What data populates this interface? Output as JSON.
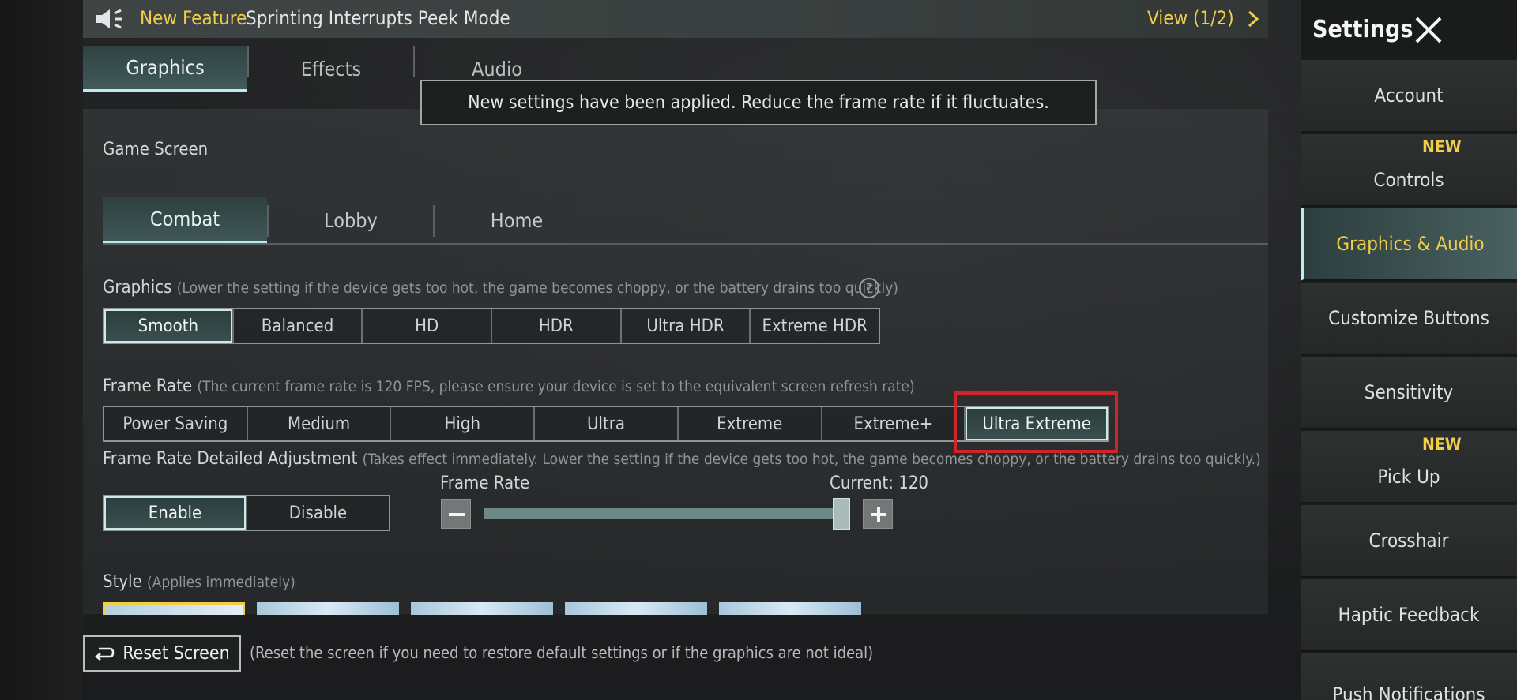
{
  "announcement": {
    "tag": "New Feature",
    "message": "Sprinting Interrupts Peek Mode",
    "view": "View (1/2)"
  },
  "main_tabs": [
    {
      "label": "Graphics",
      "active": true
    },
    {
      "label": "Effects",
      "active": false
    },
    {
      "label": "Audio",
      "active": false
    }
  ],
  "toast": "New settings have been applied. Reduce the frame rate if it fluctuates.",
  "game_screen": {
    "title": "Game Screen",
    "tabs": [
      {
        "label": "Combat",
        "active": true
      },
      {
        "label": "Lobby",
        "active": false
      },
      {
        "label": "Home",
        "active": false
      }
    ]
  },
  "graphics": {
    "label": "Graphics",
    "hint": "(Lower the setting if the device gets too hot, the game becomes choppy, or the battery drains too quickly)",
    "options": [
      "Smooth",
      "Balanced",
      "HD",
      "HDR",
      "Ultra HDR",
      "Extreme HDR"
    ],
    "selected": "Smooth"
  },
  "frame_rate": {
    "label": "Frame Rate",
    "hint": "(The current frame rate is 120 FPS, please ensure your device is set to the equivalent screen refresh rate)",
    "options": [
      "Power Saving",
      "Medium",
      "High",
      "Ultra",
      "Extreme",
      "Extreme+",
      "Ultra Extreme"
    ],
    "selected": "Ultra Extreme"
  },
  "detailed_adjustment": {
    "label": "Frame Rate Detailed Adjustment",
    "hint": "(Takes effect immediately. Lower the setting if the device gets too hot, the game becomes choppy, or the battery drains too quickly.)",
    "options": [
      "Enable",
      "Disable"
    ],
    "selected": "Enable",
    "slider_label": "Frame Rate",
    "current": "Current: 120"
  },
  "style": {
    "label": "Style",
    "hint": "(Applies immediately)"
  },
  "reset": {
    "label": "Reset Screen",
    "note": "(Reset the screen if you need to restore default settings or if the graphics are not ideal)"
  },
  "sidebar": {
    "title": "Settings",
    "items": [
      {
        "label": "Account",
        "new": ""
      },
      {
        "label": "Controls",
        "new": "NEW"
      },
      {
        "label": "Graphics & Audio",
        "new": "",
        "active": true
      },
      {
        "label": "Customize Buttons",
        "new": ""
      },
      {
        "label": "Sensitivity",
        "new": ""
      },
      {
        "label": "Pick Up",
        "new": "NEW"
      },
      {
        "label": "Crosshair",
        "new": ""
      },
      {
        "label": "Haptic Feedback",
        "new": ""
      },
      {
        "label": "Push Notifications",
        "new": ""
      }
    ]
  },
  "colors": {
    "accent_yellow": "#f1ce48",
    "active_teal": "#405757",
    "highlight_red": "#d2232a"
  }
}
